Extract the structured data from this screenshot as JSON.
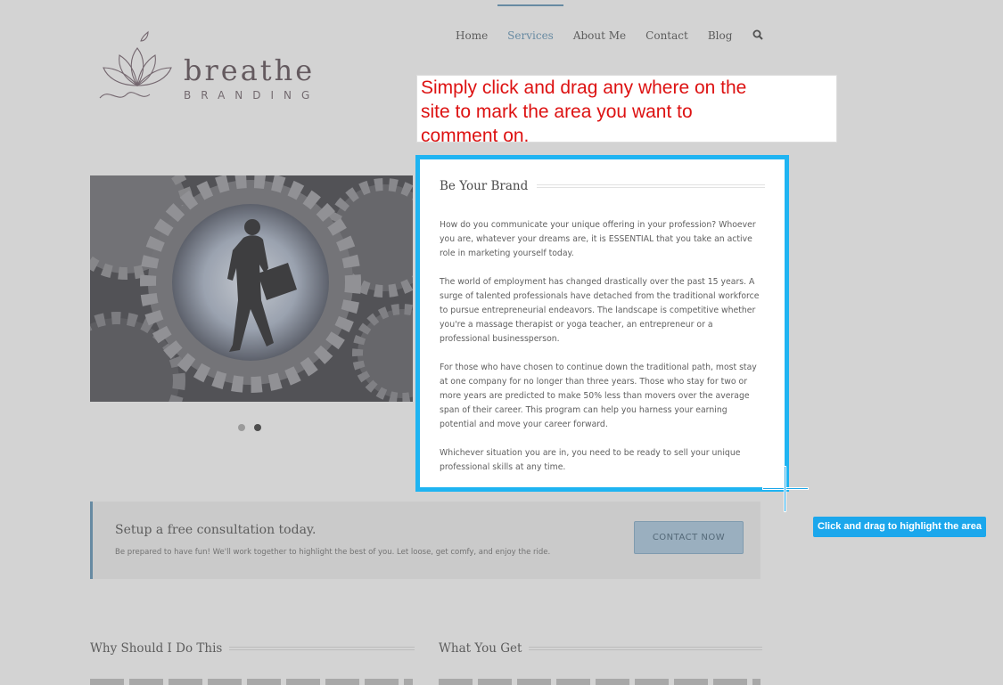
{
  "nav": {
    "items": [
      {
        "label": "Home",
        "active": false
      },
      {
        "label": "Services",
        "active": true
      },
      {
        "label": "About Me",
        "active": false
      },
      {
        "label": "Contact",
        "active": false
      },
      {
        "label": "Blog",
        "active": false
      }
    ],
    "search_icon": "search-icon"
  },
  "logo": {
    "word": "breathe",
    "sub": "BRANDING"
  },
  "slider": {
    "active_dot": 2,
    "dot_count": 2
  },
  "instruction": {
    "lines": [
      "Simply click and drag any where on the",
      "site to mark the area you want to",
      "comment on."
    ]
  },
  "card": {
    "title": "Be Your Brand",
    "paragraphs": [
      "How do you communicate your unique offering in your profession? Whoever you are, whatever your dreams are, it is ESSENTIAL that you take an active role in marketing yourself today.",
      "The world of employment has changed drastically over the past 15 years. A surge of talented professionals have detached from the traditional workforce to pursue entrepreneurial endeavors. The landscape is competitive whether you're a massage therapist or yoga teacher, an entrepreneur or a professional businessperson.",
      "For those who have chosen to continue down the traditional path, most stay at one company for no longer than three years. Those who stay for two or more years are predicted to make 50% less than movers over the average span of their career. This program can help you harness your earning potential and move your career forward.",
      "Whichever situation you are in, you need to be ready to sell your unique professional skills at any time."
    ]
  },
  "tooltip": "Click and drag to highlight the area",
  "cta": {
    "title": "Setup a free consultation today.",
    "text": "Be prepared to have fun! We'll work together to highlight the best of you. Let loose, get comfy, and enjoy the ride.",
    "button": "CONTACT NOW"
  },
  "lower": {
    "left_title": "Why Should I Do This",
    "right_title": "What You Get"
  },
  "colors": {
    "accent": "#5a8fb4",
    "highlight_border": "#1fb4f2",
    "instruction_text": "#dd1212",
    "tooltip_bg": "#1ba7ec"
  }
}
